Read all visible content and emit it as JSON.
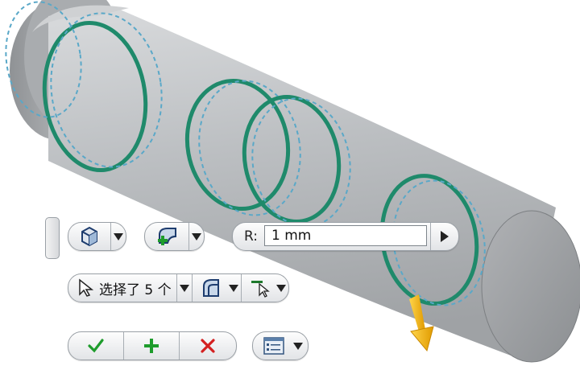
{
  "toolbar_row1": {
    "icons": [
      "part-cube-icon",
      "fillet-face-add-icon"
    ],
    "radius_label": "R:",
    "radius_value": "1 mm"
  },
  "toolbar_row2": {
    "selection_text": "选择了 5 个",
    "icons": [
      "select-arrow-icon",
      "fillet-edge-icon",
      "edge-select-icon"
    ]
  },
  "toolbar_row3": {
    "icons": [
      "apply-check-icon",
      "add-plus-icon",
      "cancel-x-icon",
      "options-list-icon"
    ]
  },
  "colors": {
    "shaft": "#b9bcbf",
    "edge_highlight": "#1f8a6b",
    "preview_dash": "#5aa8c8",
    "accept": "#1e9c2c",
    "add": "#1e9c2c",
    "cancel": "#d42020",
    "arrow": "#f0b400"
  }
}
